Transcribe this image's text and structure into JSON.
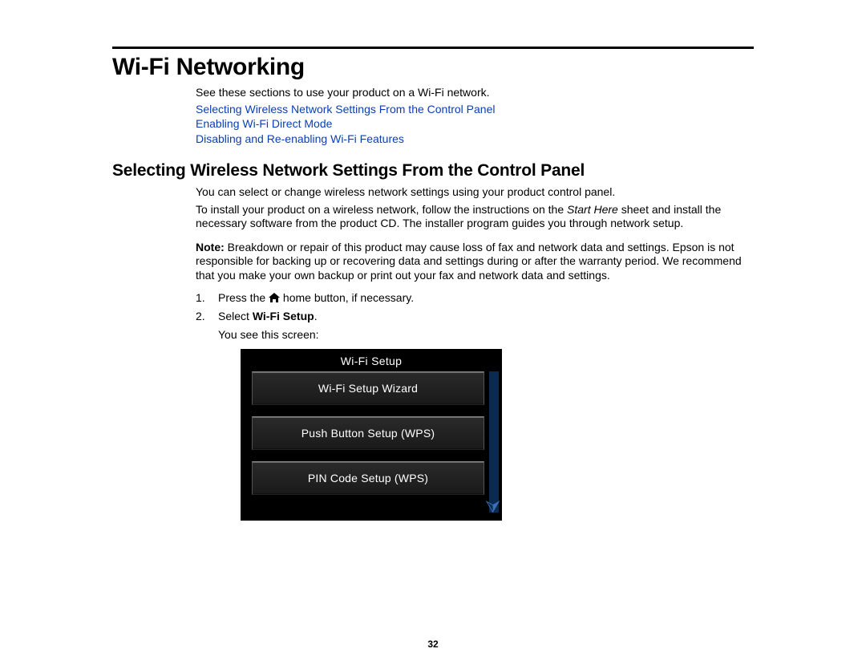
{
  "page": {
    "number": "32"
  },
  "heading1": "Wi-Fi Networking",
  "intro": "See these sections to use your product on a Wi-Fi network.",
  "links": [
    "Selecting Wireless Network Settings From the Control Panel",
    "Enabling Wi-Fi Direct Mode",
    "Disabling and Re-enabling Wi-Fi Features"
  ],
  "heading2": "Selecting Wireless Network Settings From the Control Panel",
  "body": {
    "p1": "You can select or change wireless network settings using your product control panel.",
    "p2a": "To install your product on a wireless network, follow the instructions on the ",
    "p2_italic": "Start Here",
    "p2b": " sheet and install the necessary software from the product CD. The installer program guides you through network setup.",
    "note_label": "Note:",
    "note_text": " Breakdown or repair of this product may cause loss of fax and network data and settings. Epson is not responsible for backing up or recovering data and settings during or after the warranty period. We recommend that you make your own backup or print out your fax and network data and settings."
  },
  "steps": {
    "s1_num": "1.",
    "s1a": "Press the ",
    "s1b": " home button, if necessary.",
    "s2_num": "2.",
    "s2a": "Select ",
    "s2_bold": "Wi-Fi Setup",
    "s2b": ".",
    "s2_sub": "You see this screen:"
  },
  "lcd": {
    "title": "Wi-Fi Setup",
    "items": [
      "Wi-Fi Setup Wizard",
      "Push Button Setup (WPS)",
      "PIN Code Setup (WPS)"
    ]
  }
}
